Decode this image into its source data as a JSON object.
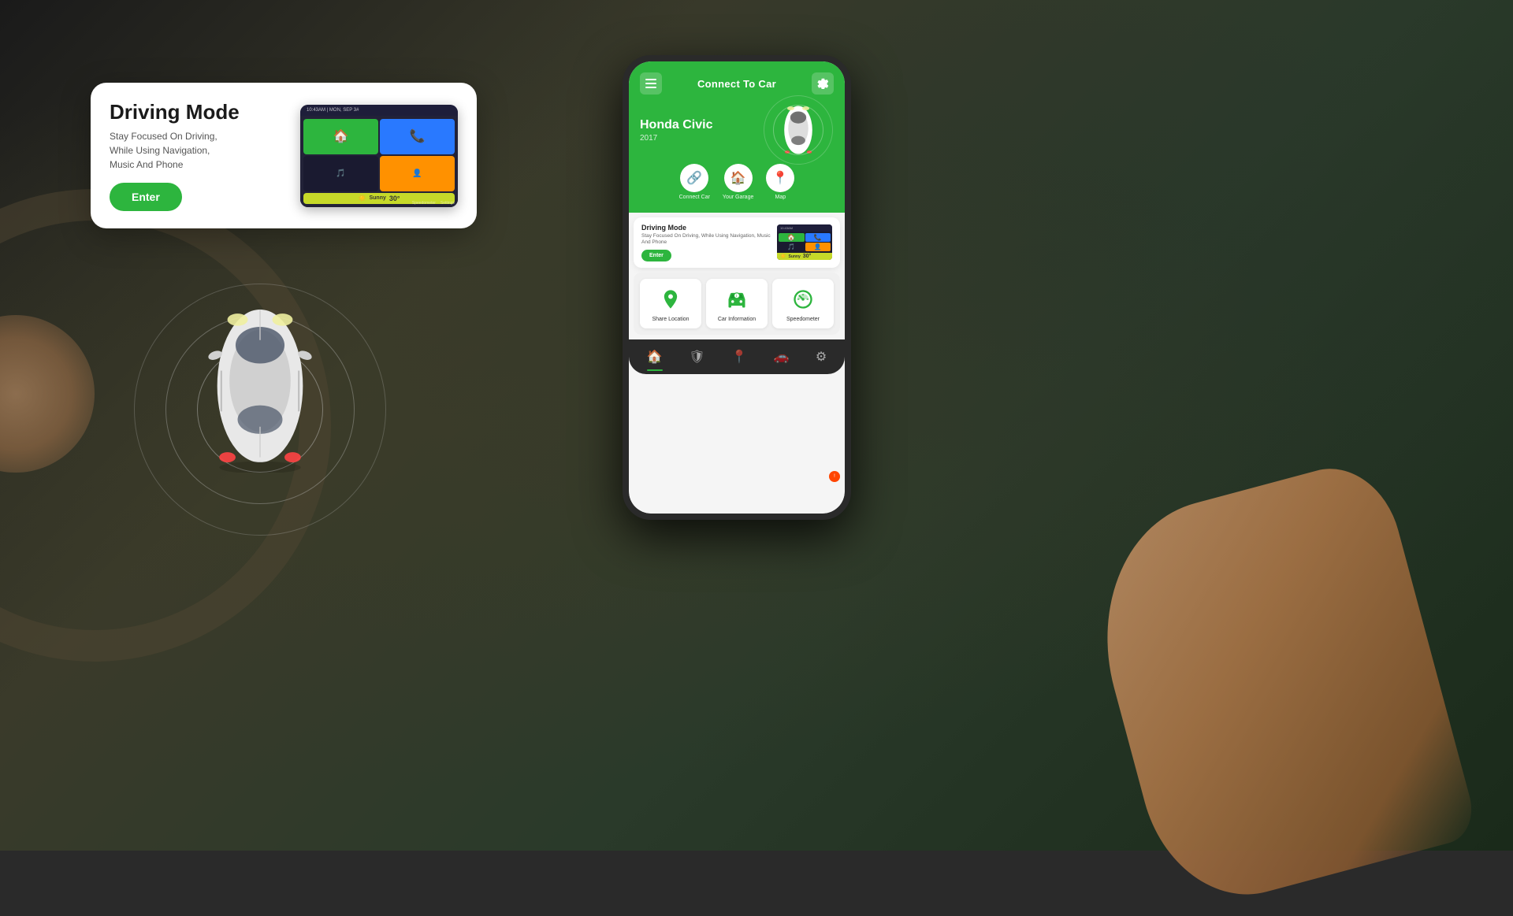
{
  "background": {
    "color": "#1a2a1a"
  },
  "driving_mode_card": {
    "title": "Driving Mode",
    "description": "Stay Focused On Driving,\nWhile Using Navigation,\nMusic And Phone",
    "enter_button": "Enter"
  },
  "phone": {
    "header": {
      "title": "Connect To Car",
      "menu_label": "menu",
      "settings_label": "settings"
    },
    "car": {
      "name": "Honda Civic",
      "year": "2017"
    },
    "quick_actions": [
      {
        "label": "Connect Car",
        "icon": "🔗"
      },
      {
        "label": "Your Garage",
        "icon": "🏠"
      },
      {
        "label": "Map",
        "icon": "📍"
      }
    ],
    "driving_mode_mini": {
      "title": "Driving Mode",
      "description": "Stay Focused On Driving, While Using Navigation, Music And Phone",
      "enter_button": "Enter"
    },
    "grid_items": [
      {
        "label": "Share Location",
        "icon": "📍"
      },
      {
        "label": "Car Information",
        "icon": "🚗"
      },
      {
        "label": "Speedometer",
        "icon": "⏱"
      }
    ],
    "bottom_nav": [
      {
        "icon": "🏠",
        "label": "home",
        "active": true
      },
      {
        "icon": "🛡",
        "label": "shield"
      },
      {
        "icon": "📍",
        "label": "location"
      },
      {
        "icon": "🏎",
        "label": "car"
      },
      {
        "icon": "⚙",
        "label": "settings"
      }
    ]
  }
}
